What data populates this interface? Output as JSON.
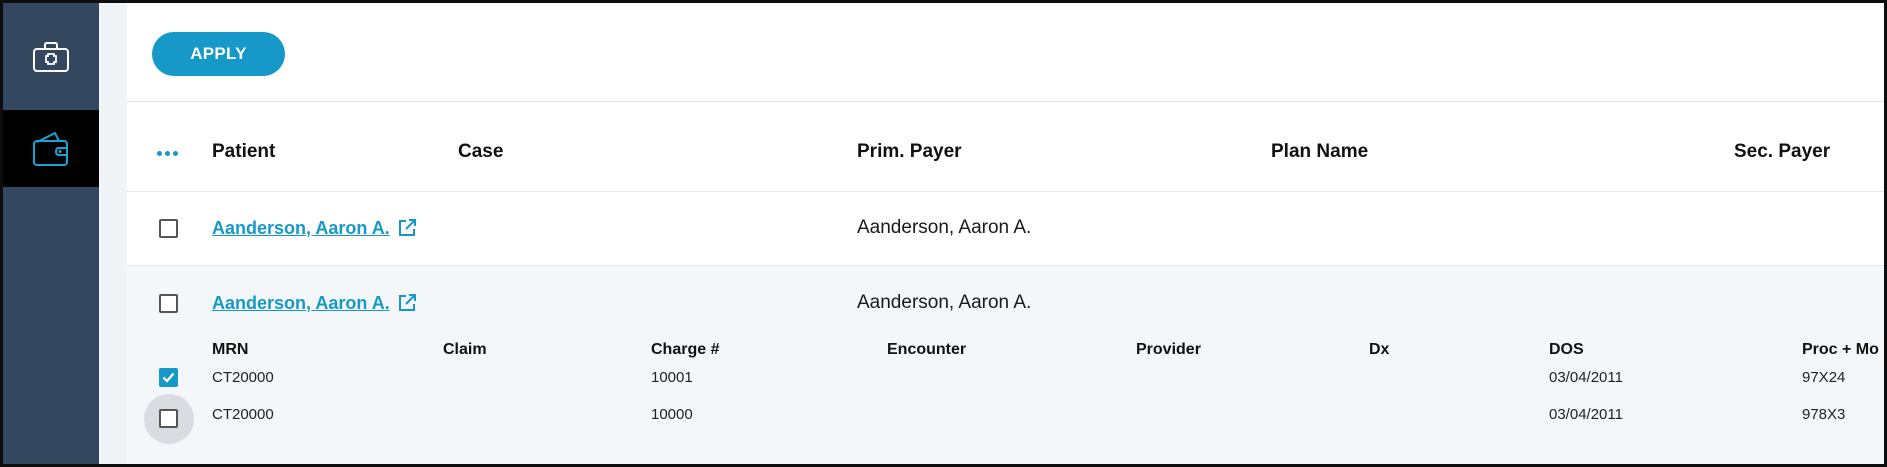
{
  "sidebar": {
    "items": [
      {
        "name": "medical-kit-icon"
      },
      {
        "name": "wallet-icon",
        "active": true
      }
    ]
  },
  "toolbar": {
    "apply_label": "APPLY"
  },
  "table": {
    "columns": [
      "Patient",
      "Case",
      "Prim. Payer",
      "Plan Name",
      "Sec. Payer"
    ],
    "rows": [
      {
        "patient": "Aanderson, Aaron A.",
        "case": "",
        "prim_payer": "Aanderson, Aaron A.",
        "plan_name": "",
        "sec_payer": "",
        "selected": false
      },
      {
        "patient": "Aanderson, Aaron A.",
        "case": "",
        "prim_payer": "Aanderson, Aaron A.",
        "plan_name": "",
        "sec_payer": "",
        "selected": false,
        "expanded": true
      }
    ]
  },
  "claims": {
    "columns": [
      "MRN",
      "Claim",
      "Charge #",
      "Encounter",
      "Provider",
      "Dx",
      "DOS",
      "Proc + Mo"
    ],
    "rows": [
      {
        "mrn": "CT20000",
        "claim": "",
        "charge": "10001",
        "encounter": "",
        "provider": "",
        "dx": "",
        "dos": "03/04/2011",
        "proc": "97X24",
        "selected": true
      },
      {
        "mrn": "CT20000",
        "claim": "",
        "charge": "10000",
        "encounter": "",
        "provider": "",
        "dx": "",
        "dos": "03/04/2011",
        "proc": "978X3",
        "selected": false
      }
    ]
  },
  "colors": {
    "accent": "#1699c9",
    "sidebar": "#33485f",
    "sidebar_active": "#000000",
    "expanded_row": "#f3f7fa"
  }
}
